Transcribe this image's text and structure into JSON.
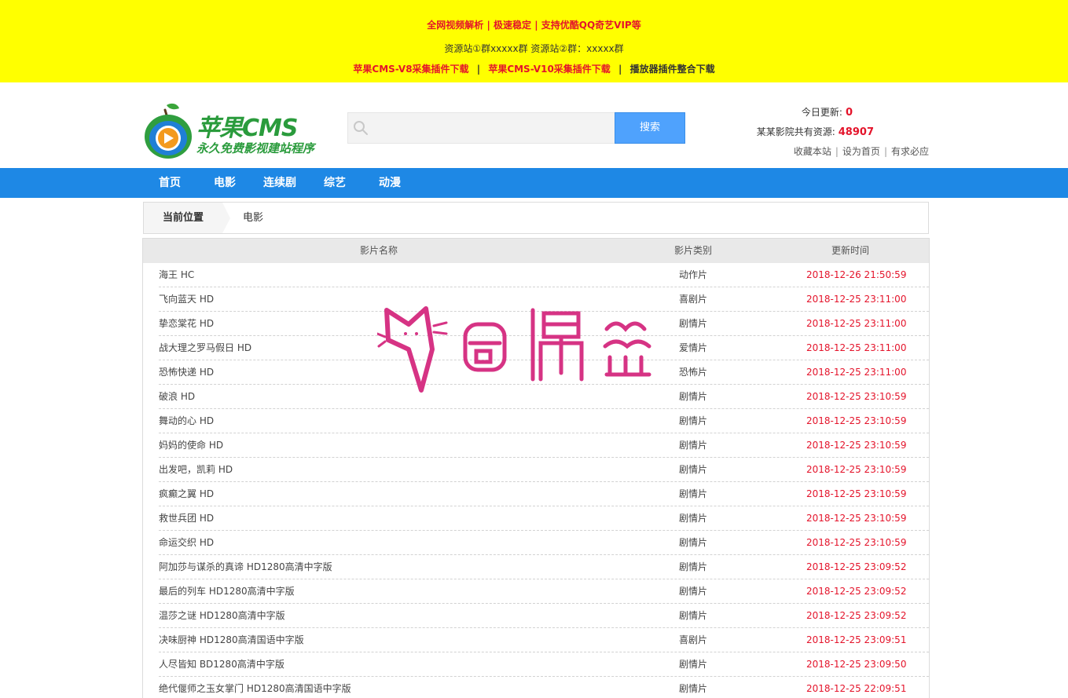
{
  "notice": {
    "line1": "全网视频解析 | 极速稳定 | 支持优酷QQ奇艺VIP等",
    "line2": "资源站①群xxxxx群 资源站②群：xxxxx群",
    "link_v8": "苹果CMS-V8采集插件下载",
    "link_v10": "苹果CMS-V10采集插件下载",
    "link_player": "播放器插件整合下载",
    "separator": "|"
  },
  "logo": {
    "title": "苹果CMS",
    "subtitle": "永久免费影视建站程序"
  },
  "search": {
    "placeholder": "",
    "button_label": "搜索"
  },
  "stats": {
    "today_label": "今日更新:",
    "today_value": "0",
    "total_label": "某某影院共有资源:",
    "total_value": "48907",
    "links": [
      "收藏本站",
      "设为首页",
      "有求必应"
    ],
    "pipe": "|"
  },
  "nav": {
    "items": [
      "首页",
      "电影",
      "连续剧",
      "综艺",
      "动漫"
    ]
  },
  "breadcrumb": {
    "label": "当前位置",
    "current": "电影"
  },
  "table": {
    "headers": [
      "影片名称",
      "影片类别",
      "更新时间"
    ],
    "rows": [
      {
        "name": "海王 HC",
        "category": "动作片",
        "time": "2018-12-26 21:50:59"
      },
      {
        "name": "飞向蓝天 HD",
        "category": "喜剧片",
        "time": "2018-12-25 23:11:00"
      },
      {
        "name": "挚恋棠花 HD",
        "category": "剧情片",
        "time": "2018-12-25 23:11:00"
      },
      {
        "name": "战大理之罗马假日 HD",
        "category": "爱情片",
        "time": "2018-12-25 23:11:00"
      },
      {
        "name": "恐怖快递 HD",
        "category": "恐怖片",
        "time": "2018-12-25 23:11:00"
      },
      {
        "name": "破浪 HD",
        "category": "剧情片",
        "time": "2018-12-25 23:10:59"
      },
      {
        "name": "舞动的心 HD",
        "category": "剧情片",
        "time": "2018-12-25 23:10:59"
      },
      {
        "name": "妈妈的使命 HD",
        "category": "剧情片",
        "time": "2018-12-25 23:10:59"
      },
      {
        "name": "出发吧，凯莉 HD",
        "category": "剧情片",
        "time": "2018-12-25 23:10:59"
      },
      {
        "name": "疯癫之翼 HD",
        "category": "剧情片",
        "time": "2018-12-25 23:10:59"
      },
      {
        "name": "救世兵团 HD",
        "category": "剧情片",
        "time": "2018-12-25 23:10:59"
      },
      {
        "name": "命运交织 HD",
        "category": "剧情片",
        "time": "2018-12-25 23:10:59"
      },
      {
        "name": "阿加莎与谋杀的真谛 HD1280高清中字版",
        "category": "剧情片",
        "time": "2018-12-25 23:09:52"
      },
      {
        "name": "最后的列车 HD1280高清中字版",
        "category": "剧情片",
        "time": "2018-12-25 23:09:52"
      },
      {
        "name": "温莎之谜 HD1280高清中字版",
        "category": "剧情片",
        "time": "2018-12-25 23:09:52"
      },
      {
        "name": "决味厨神 HD1280高清国语中字版",
        "category": "喜剧片",
        "time": "2018-12-25 23:09:51"
      },
      {
        "name": "人尽皆知 BD1280高清中字版",
        "category": "剧情片",
        "time": "2018-12-25 23:09:50"
      },
      {
        "name": "绝代偃师之玉女掌门 HD1280高清国语中字版",
        "category": "剧情片",
        "time": "2018-12-25 22:09:51"
      }
    ]
  },
  "watermark": {
    "text": "奇偶猫"
  },
  "colors": {
    "notice_bg": "#ffff00",
    "accent_red": "#e4142b",
    "nav_blue": "#1e88e5",
    "button_blue": "#4fa2fd",
    "logo_green": "#2a9b3c",
    "watermark_pink": "#d63384"
  }
}
